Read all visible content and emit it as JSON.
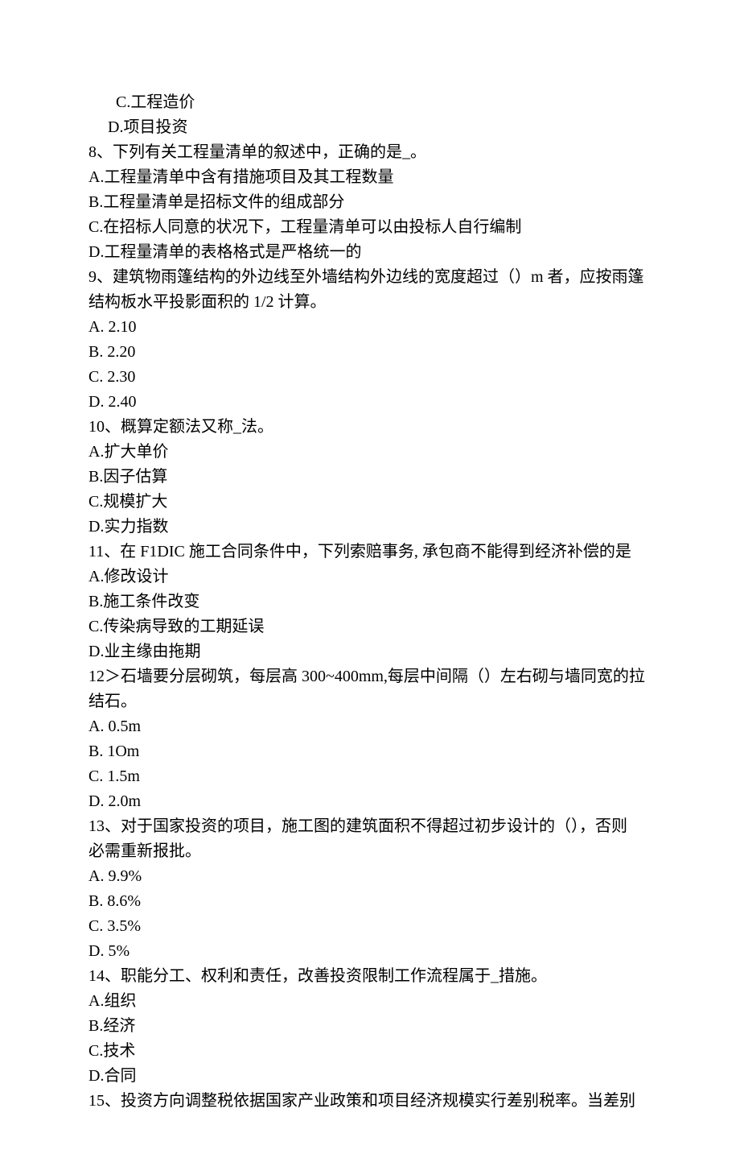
{
  "lines": [
    {
      "cls": "indent1",
      "name": "q7-option-c",
      "bind": "q7.c"
    },
    {
      "cls": "indent2",
      "name": "q7-option-d",
      "bind": "q7.d"
    },
    {
      "cls": "",
      "name": "q8-stem",
      "bind": "q8.stem"
    },
    {
      "cls": "",
      "name": "q8-option-a",
      "bind": "q8.a"
    },
    {
      "cls": "",
      "name": "q8-option-b",
      "bind": "q8.b"
    },
    {
      "cls": "",
      "name": "q8-option-c",
      "bind": "q8.c"
    },
    {
      "cls": "",
      "name": "q8-option-d",
      "bind": "q8.d"
    },
    {
      "cls": "",
      "name": "q9-stem-line1",
      "bind": "q9.stem1"
    },
    {
      "cls": "",
      "name": "q9-stem-line2",
      "bind": "q9.stem2"
    },
    {
      "cls": "",
      "name": "q9-option-a",
      "bind": "q9.a"
    },
    {
      "cls": "",
      "name": "q9-option-b",
      "bind": "q9.b"
    },
    {
      "cls": "",
      "name": "q9-option-c",
      "bind": "q9.c"
    },
    {
      "cls": "",
      "name": "q9-option-d",
      "bind": "q9.d"
    },
    {
      "cls": "",
      "name": "q10-stem",
      "bind": "q10.stem"
    },
    {
      "cls": "",
      "name": "q10-option-a",
      "bind": "q10.a"
    },
    {
      "cls": "",
      "name": "q10-option-b",
      "bind": "q10.b"
    },
    {
      "cls": "",
      "name": "q10-option-c",
      "bind": "q10.c"
    },
    {
      "cls": "",
      "name": "q10-option-d",
      "bind": "q10.d"
    },
    {
      "cls": "",
      "name": "q11-stem",
      "bind": "q11.stem"
    },
    {
      "cls": "",
      "name": "q11-option-a",
      "bind": "q11.a"
    },
    {
      "cls": "",
      "name": "q11-option-b",
      "bind": "q11.b"
    },
    {
      "cls": "",
      "name": "q11-option-c",
      "bind": "q11.c"
    },
    {
      "cls": "",
      "name": "q11-option-d",
      "bind": "q11.d"
    },
    {
      "cls": "",
      "name": "q12-stem-line1",
      "bind": "q12.stem1"
    },
    {
      "cls": "",
      "name": "q12-stem-line2",
      "bind": "q12.stem2"
    },
    {
      "cls": "",
      "name": "q12-option-a",
      "bind": "q12.a"
    },
    {
      "cls": "",
      "name": "q12-option-b",
      "bind": "q12.b"
    },
    {
      "cls": "",
      "name": "q12-option-c",
      "bind": "q12.c"
    },
    {
      "cls": "",
      "name": "q12-option-d",
      "bind": "q12.d"
    },
    {
      "cls": "",
      "name": "q13-stem-line1",
      "bind": "q13.stem1"
    },
    {
      "cls": "",
      "name": "q13-stem-line2",
      "bind": "q13.stem2"
    },
    {
      "cls": "",
      "name": "q13-option-a",
      "bind": "q13.a"
    },
    {
      "cls": "",
      "name": "q13-option-b",
      "bind": "q13.b"
    },
    {
      "cls": "",
      "name": "q13-option-c",
      "bind": "q13.c"
    },
    {
      "cls": "",
      "name": "q13-option-d",
      "bind": "q13.d"
    },
    {
      "cls": "",
      "name": "q14-stem",
      "bind": "q14.stem"
    },
    {
      "cls": "",
      "name": "q14-option-a",
      "bind": "q14.a"
    },
    {
      "cls": "",
      "name": "q14-option-b",
      "bind": "q14.b"
    },
    {
      "cls": "",
      "name": "q14-option-c",
      "bind": "q14.c"
    },
    {
      "cls": "",
      "name": "q14-option-d",
      "bind": "q14.d"
    },
    {
      "cls": "",
      "name": "q15-stem",
      "bind": "q15.stem"
    }
  ],
  "q7": {
    "c": "C.工程造价",
    "d": "D.项目投资"
  },
  "q8": {
    "stem": "8、下列有关工程量清单的叙述中，正确的是_。",
    "a": "A.工程量清单中含有措施项目及其工程数量",
    "b": "B.工程量清单是招标文件的组成部分",
    "c": "C.在招标人同意的状况下，工程量清单可以由投标人自行编制",
    "d": "D.工程量清单的表格格式是严格统一的"
  },
  "q9": {
    "stem1": "9、建筑物雨篷结构的外边线至外墙结构外边线的宽度超过（）m 者，应按雨篷",
    "stem2": "结构板水平投影面积的 1/2 计算。",
    "a": "A.   2.10",
    "b": "B.   2.20",
    "c": "C.   2.30",
    "d": "D.   2.40"
  },
  "q10": {
    "stem": "10、概算定额法又称_法。",
    "a": "A.扩大单价",
    "b": "B.因子估算",
    "c": "C.规模扩大",
    "d": "D.实力指数"
  },
  "q11": {
    "stem": "11、在 F1DIC 施工合同条件中，下列索赔事务, 承包商不能得到经济补偿的是",
    "a": "A.修改设计",
    "b": "B.施工条件改变",
    "c": "C.传染病导致的工期延误",
    "d": "D.业主缘由拖期"
  },
  "q12": {
    "stem1": "12＞石墙要分层砌筑，每层高 300~400mm,每层中间隔（）左右砌与墙同宽的拉",
    "stem2": "结石。",
    "a": "A.   0.5m",
    "b": "B.   1Om",
    "c": "C.   1.5m",
    "d": "D.   2.0m"
  },
  "q13": {
    "stem1": "13、对于国家投资的项目，施工图的建筑面积不得超过初步设计的（），否则",
    "stem2": "必需重新报批。",
    "a": "A.   9.9%",
    "b": "B.   8.6%",
    "c": "C.   3.5%",
    "d": "D.   5%"
  },
  "q14": {
    "stem": "14、职能分工、权利和责任，改善投资限制工作流程属于_措施。",
    "a": "A.组织",
    "b": "B.经济",
    "c": "C.技术",
    "d": "D.合同"
  },
  "q15": {
    "stem": "15、投资方向调整税依据国家产业政策和项目经济规模实行差别税率。当差别"
  }
}
